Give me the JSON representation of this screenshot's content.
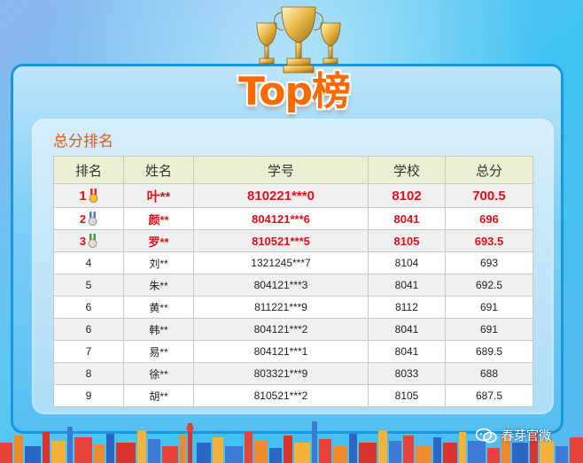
{
  "banner": {
    "title": "Top榜"
  },
  "section": {
    "title": "总分排名"
  },
  "table": {
    "headers": [
      "排名",
      "姓名",
      "学号",
      "学校",
      "总分"
    ],
    "rows": [
      {
        "rank": "1",
        "name": "叶**",
        "id": "810221***0",
        "school": "8102",
        "score": "700.5",
        "medal": "gold"
      },
      {
        "rank": "2",
        "name": "颜**",
        "id": "804121***6",
        "school": "8041",
        "score": "696",
        "medal": "silver"
      },
      {
        "rank": "3",
        "name": "罗**",
        "id": "810521***5",
        "school": "8105",
        "score": "693.5",
        "medal": "bronze"
      },
      {
        "rank": "4",
        "name": "刘**",
        "id": "1321245***7",
        "school": "8104",
        "score": "693"
      },
      {
        "rank": "5",
        "name": "朱**",
        "id": "804121***3",
        "school": "8041",
        "score": "692.5"
      },
      {
        "rank": "6",
        "name": "黄**",
        "id": "811221***9",
        "school": "8112",
        "score": "691"
      },
      {
        "rank": "6",
        "name": "韩**",
        "id": "804121***2",
        "school": "8041",
        "score": "691"
      },
      {
        "rank": "7",
        "name": "易**",
        "id": "804121***1",
        "school": "8041",
        "score": "689.5"
      },
      {
        "rank": "8",
        "name": "徐**",
        "id": "803321***9",
        "school": "8033",
        "score": "688"
      },
      {
        "rank": "9",
        "name": "胡**",
        "id": "810521***2",
        "school": "8105",
        "score": "687.5"
      }
    ]
  },
  "watermark": {
    "text": "春芽官微",
    "icon": "wechat-icon"
  },
  "colors": {
    "accent_orange": "#ff6a00",
    "top_red": "#e0101a",
    "header_bg": "#eaf1d2",
    "panel_border": "#1797dd"
  }
}
